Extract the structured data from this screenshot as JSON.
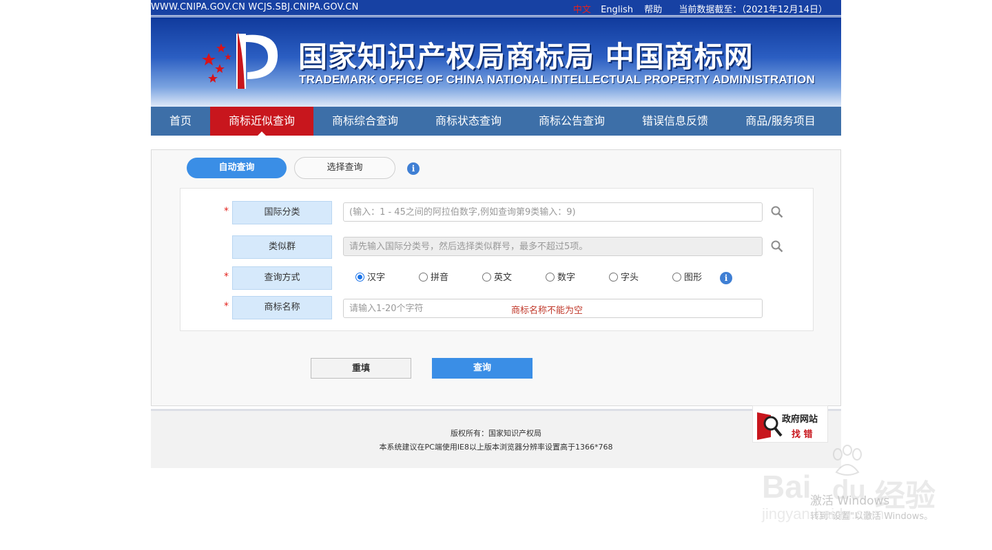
{
  "topbar": {
    "sites": "WWW.CNIPA.GOV.CN WCJS.SBJ.CNIPA.GOV.CN",
    "lang_cn": "中文",
    "lang_en": "English",
    "help": "帮助",
    "data_date": "当前数据截至：（2021年12月14日）"
  },
  "banner": {
    "title_cn": "国家知识产权局商标局 中国商标网",
    "title_en": "TRADEMARK OFFICE OF CHINA NATIONAL INTELLECTUAL PROPERTY ADMINISTRATION"
  },
  "nav": {
    "items": [
      {
        "label": "首页"
      },
      {
        "label": "商标近似查询"
      },
      {
        "label": "商标综合查询"
      },
      {
        "label": "商标状态查询"
      },
      {
        "label": "商标公告查询"
      },
      {
        "label": "错误信息反馈"
      },
      {
        "label": "商品/服务项目"
      }
    ],
    "active_index": 1
  },
  "tabs": {
    "auto": "自动查询",
    "select": "选择查询"
  },
  "form": {
    "required_mark": "*",
    "class_label": "国际分类",
    "class_placeholder": "(输入：1 - 45之间的阿拉伯数字,例如查询第9类输入：9)",
    "group_label": "类似群",
    "group_placeholder": "请先输入国际分类号，然后选择类似群号，最多不超过5项。",
    "method_label": "查询方式",
    "methods": [
      "汉字",
      "拼音",
      "英文",
      "数字",
      "字头",
      "图形"
    ],
    "method_selected": "汉字",
    "name_label": "商标名称",
    "name_placeholder": "请输入1-20个字符",
    "name_error": "商标名称不能为空"
  },
  "buttons": {
    "reset": "重填",
    "query": "查询"
  },
  "footer": {
    "copyright": "版权所有：国家知识产权局",
    "advice": "本系统建议在PC端使用IE8以上版本浏览器分辨率设置高于1366*768"
  },
  "gov_badge": {
    "line1": "政府网站",
    "line2": "找 错"
  },
  "watermark": {
    "brand_latin1": "Bai",
    "brand_latin2": "du",
    "brand_cn": "经验",
    "site": "jingyan.baidu.com",
    "activate_title": "激活 Windows",
    "activate_sub": "转到\"设置\"以激活 Windows。"
  },
  "colors": {
    "nav_bg": "#3d6fa8",
    "nav_active": "#c8161d",
    "accent_blue": "#3a8ee6",
    "label_bg": "#d6e9fb",
    "error_red": "#c0392b"
  }
}
